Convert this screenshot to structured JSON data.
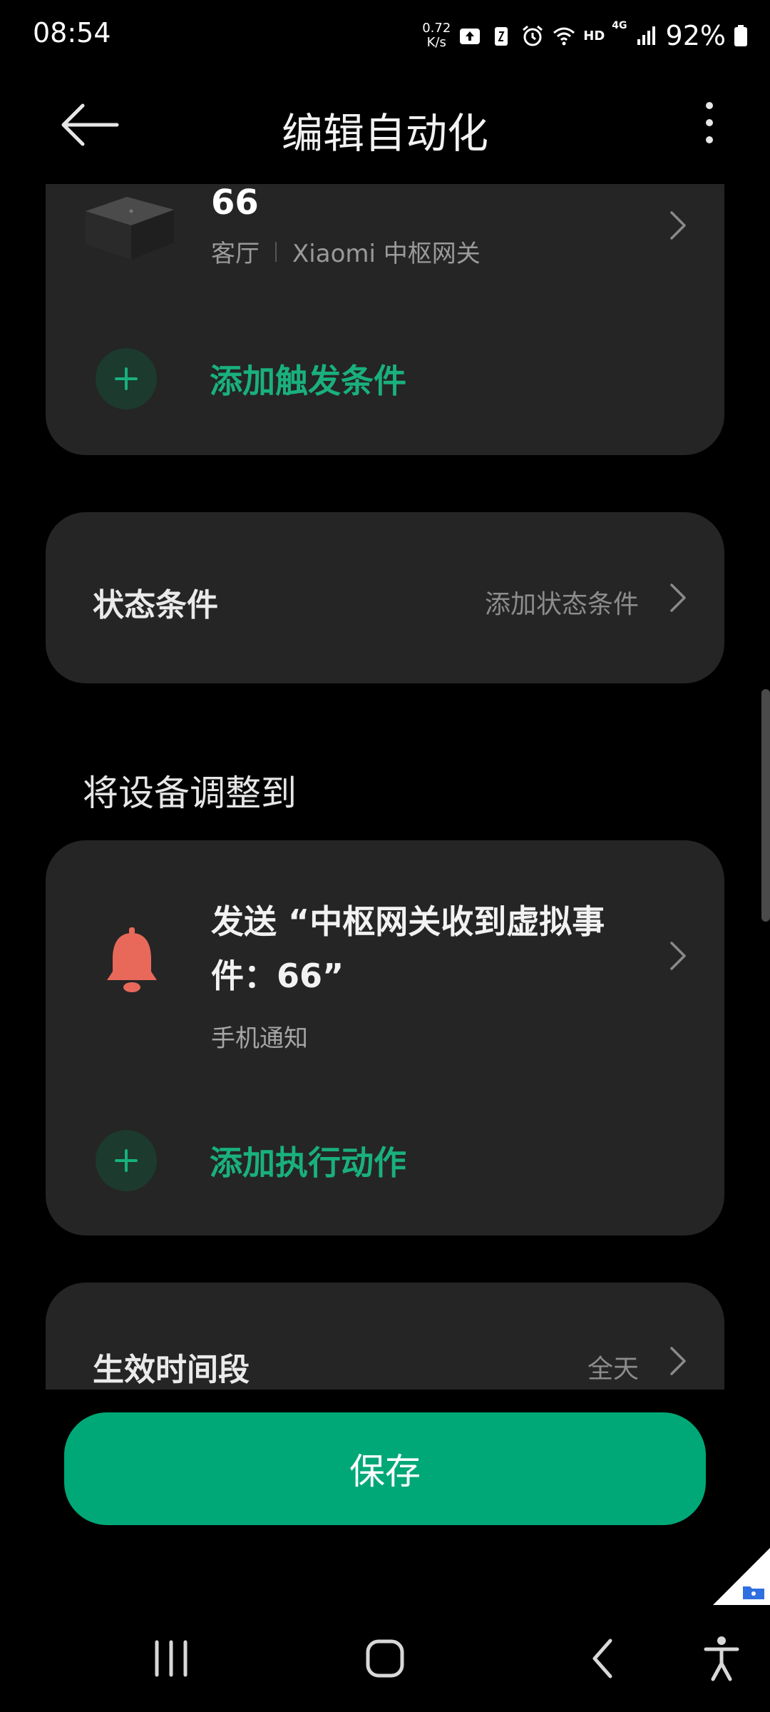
{
  "status_bar": {
    "time": "08:54",
    "net_speed_value": "0.72",
    "net_speed_unit": "K/s",
    "hd_label": "HD",
    "lte_label": "4G",
    "battery": "92%"
  },
  "app_bar": {
    "title": "编辑自动化"
  },
  "trigger_card": {
    "device_name": "66",
    "room": "客厅",
    "device_model": "Xiaomi 中枢网关",
    "add_trigger_label": "添加触发条件"
  },
  "state_card": {
    "title": "状态条件",
    "value": "添加状态条件"
  },
  "action_section": {
    "label": "将设备调整到",
    "action_title": "发送 “中枢网关收到虚拟事件：66”",
    "action_subtitle": "手机通知",
    "add_action_label": "添加执行动作"
  },
  "time_card": {
    "title": "生效时间段",
    "value": "全天"
  },
  "save_button": {
    "label": "保存"
  },
  "colors": {
    "accent": "#00a877",
    "accent_text": "#19b07e",
    "card_bg": "#252525",
    "bell": "#e8695a"
  }
}
